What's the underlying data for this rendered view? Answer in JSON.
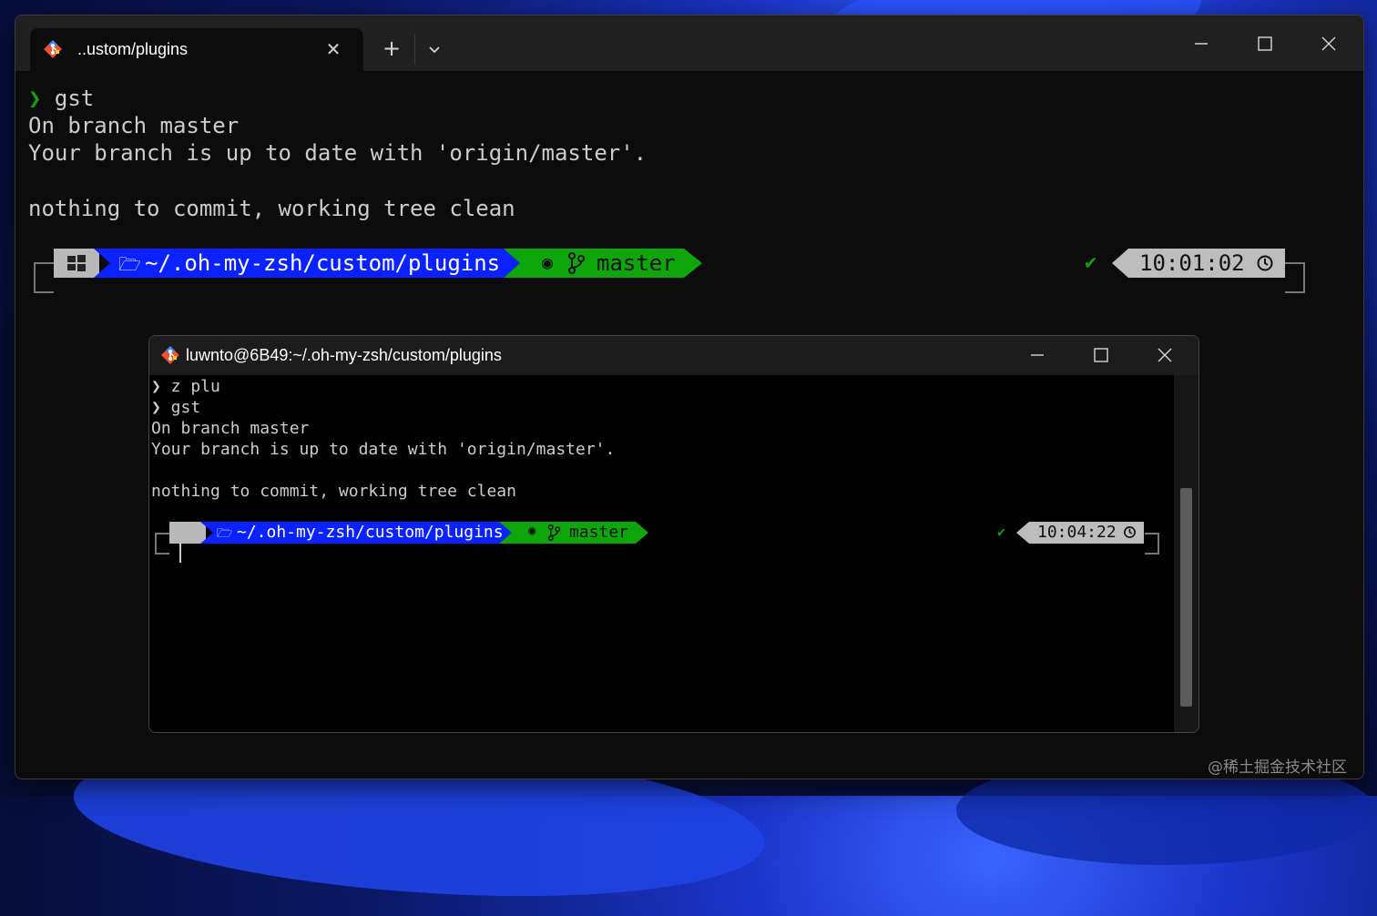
{
  "main_window": {
    "tab_title": "..ustom/plugins",
    "tab_close": "✕",
    "new_tab": "+",
    "lines": [
      {
        "prompt": "❯",
        "text": " gst"
      },
      {
        "text": "On branch master"
      },
      {
        "text": "Your branch is up to date with 'origin/master'."
      },
      {
        "text": ""
      },
      {
        "text": "nothing to commit, working tree clean"
      }
    ],
    "prompt_bar": {
      "path": "~/.oh-my-zsh/custom/plugins",
      "branch": "master",
      "check": "✔",
      "time": "10:01:02"
    }
  },
  "inner_window": {
    "title": "luwnto@6B49:~/.oh-my-zsh/custom/plugins",
    "lines": [
      {
        "text": "❯ z plu"
      },
      {
        "text": "❯ gst"
      },
      {
        "text": "On branch master"
      },
      {
        "text": "Your branch is up to date with 'origin/master'."
      },
      {
        "text": ""
      },
      {
        "text": "nothing to commit, working tree clean"
      }
    ],
    "prompt_bar": {
      "path": "~/.oh-my-zsh/custom/plugins",
      "branch": "master",
      "check": "✔",
      "time": "10:04:22"
    }
  },
  "watermark": "@稀土掘金技术社区",
  "colors": {
    "path_segment": "#0a22ff",
    "git_segment": "#0ea60a",
    "os_segment": "#b8b8b8",
    "time_segment": "#bdbdbd",
    "prompt_green": "#13a10e"
  }
}
